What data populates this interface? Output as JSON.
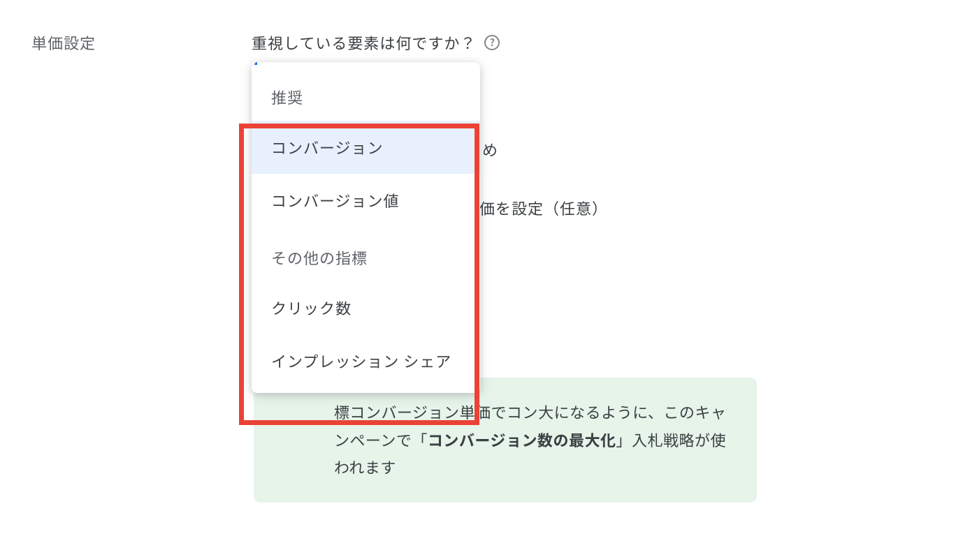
{
  "section": {
    "label": "単価設定"
  },
  "question": {
    "text": "重視している要素は何ですか？"
  },
  "dropdown": {
    "group1_header": "推奨",
    "items": {
      "conversions": "コンバージョン",
      "conversion_value": "コンバージョン値"
    },
    "group2_header": "その他の指標",
    "items2": {
      "clicks": "クリック数",
      "impression_share": "インプレッション シェア"
    }
  },
  "behind": {
    "line1": "め",
    "line2": "価を設定（任意）"
  },
  "info": {
    "t1": "標コンバージョン単価でコン",
    "t2": "大になるように、このキャンペーンで「",
    "bold": "コンバージョン数の最大化",
    "t3": "」入札戦略が使われます"
  }
}
